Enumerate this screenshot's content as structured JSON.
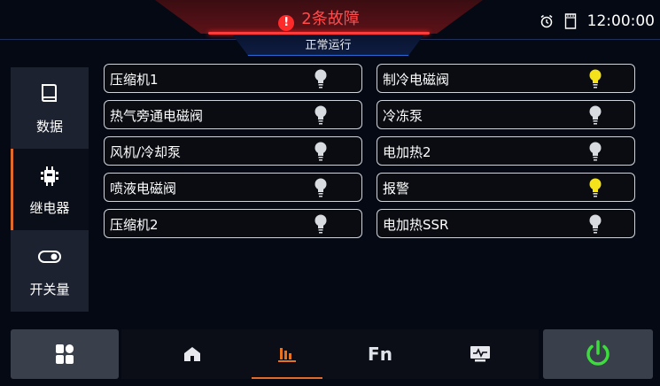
{
  "header": {
    "fault_text": "2条故障",
    "fault_icon": "alert-circle-icon",
    "status_text": "正常运行",
    "time": "12:00:00",
    "fault_color": "#ff4b4b"
  },
  "sidebar": {
    "items": [
      {
        "label": "数据",
        "icon": "book-icon",
        "active": false
      },
      {
        "label": "继电器",
        "icon": "relay-icon",
        "active": true
      },
      {
        "label": "开关量",
        "icon": "toggle-icon",
        "active": false
      }
    ],
    "active_color": "#e06a2a"
  },
  "relays": {
    "left": [
      {
        "label": "压缩机1",
        "on": false
      },
      {
        "label": "热气旁通电磁阀",
        "on": false
      },
      {
        "label": "风机/冷却泵",
        "on": false
      },
      {
        "label": "喷液电磁阀",
        "on": false
      },
      {
        "label": "压缩机2",
        "on": false
      }
    ],
    "right": [
      {
        "label": "制冷电磁阀",
        "on": true
      },
      {
        "label": "冷冻泵",
        "on": false
      },
      {
        "label": "电加热2",
        "on": false
      },
      {
        "label": "报警",
        "on": true
      },
      {
        "label": "电加热SSR",
        "on": false
      }
    ],
    "bulb_on_color": "#f3e21c",
    "bulb_off_color": "#d8dbe0"
  },
  "bottom_nav": {
    "items": [
      {
        "icon": "home-icon"
      },
      {
        "icon": "bar-chart-icon",
        "active": true
      },
      {
        "label": "Fn"
      },
      {
        "icon": "monitor-icon"
      }
    ],
    "power_icon": "power-icon",
    "power_color": "#3ddc3d"
  }
}
